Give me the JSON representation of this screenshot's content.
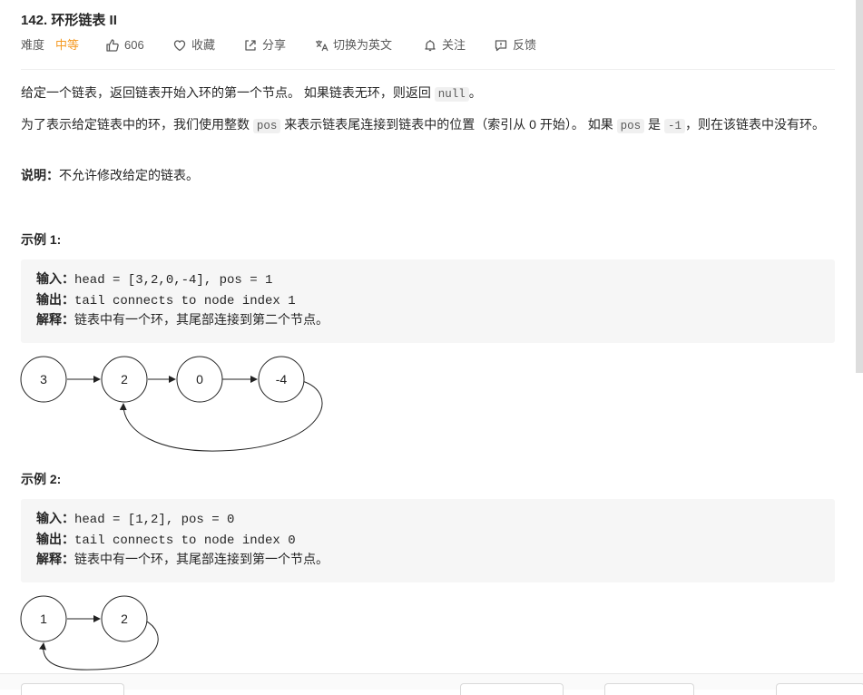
{
  "problem": {
    "title": "142. 环形链表 II"
  },
  "meta": {
    "difficulty_label": "难度",
    "difficulty_value": "中等",
    "likes": "606",
    "favorite": "收藏",
    "share": "分享",
    "switch_lang": "切换为英文",
    "follow": "关注",
    "feedback": "反馈"
  },
  "description": {
    "p1_text": "给定一个链表，返回链表开始入环的第一个节点。 如果链表无环，则返回 ",
    "p1_code": "null",
    "p1_end": "。",
    "p2_a": "为了表示给定链表中的环，我们使用整数 ",
    "p2_code1": "pos",
    "p2_b": " 来表示链表尾连接到链表中的位置（索引从 0 开始）。 如果 ",
    "p2_code2": "pos",
    "p2_c": " 是 ",
    "p2_code3": "-1",
    "p2_d": "，则在该链表中没有环。",
    "note_label": "说明：",
    "note_text": "不允许修改给定的链表。"
  },
  "examples": [
    {
      "heading": "示例 1:",
      "input_label": "输入：",
      "input": "head = [3,2,0,-4], pos = 1",
      "output_label": "输出：",
      "output": "tail connects to node index 1",
      "explain_label": "解释：",
      "explain": "链表中有一个环，其尾部连接到第二个节点。",
      "nodes": [
        "3",
        "2",
        "0",
        "-4"
      ]
    },
    {
      "heading": "示例 2:",
      "input_label": "输入：",
      "input": "head = [1,2], pos = 0",
      "output_label": "输出：",
      "output": "tail connects to node index 0",
      "explain_label": "解释：",
      "explain": "链表中有一个环，其尾部连接到第一个节点。",
      "nodes": [
        "1",
        "2"
      ]
    }
  ],
  "icons": {
    "likes": "thumbs-up-icon",
    "favorite": "heart-icon",
    "share": "share-icon",
    "switch_lang": "translate-icon",
    "follow": "bell-icon",
    "feedback": "feedback-icon"
  }
}
